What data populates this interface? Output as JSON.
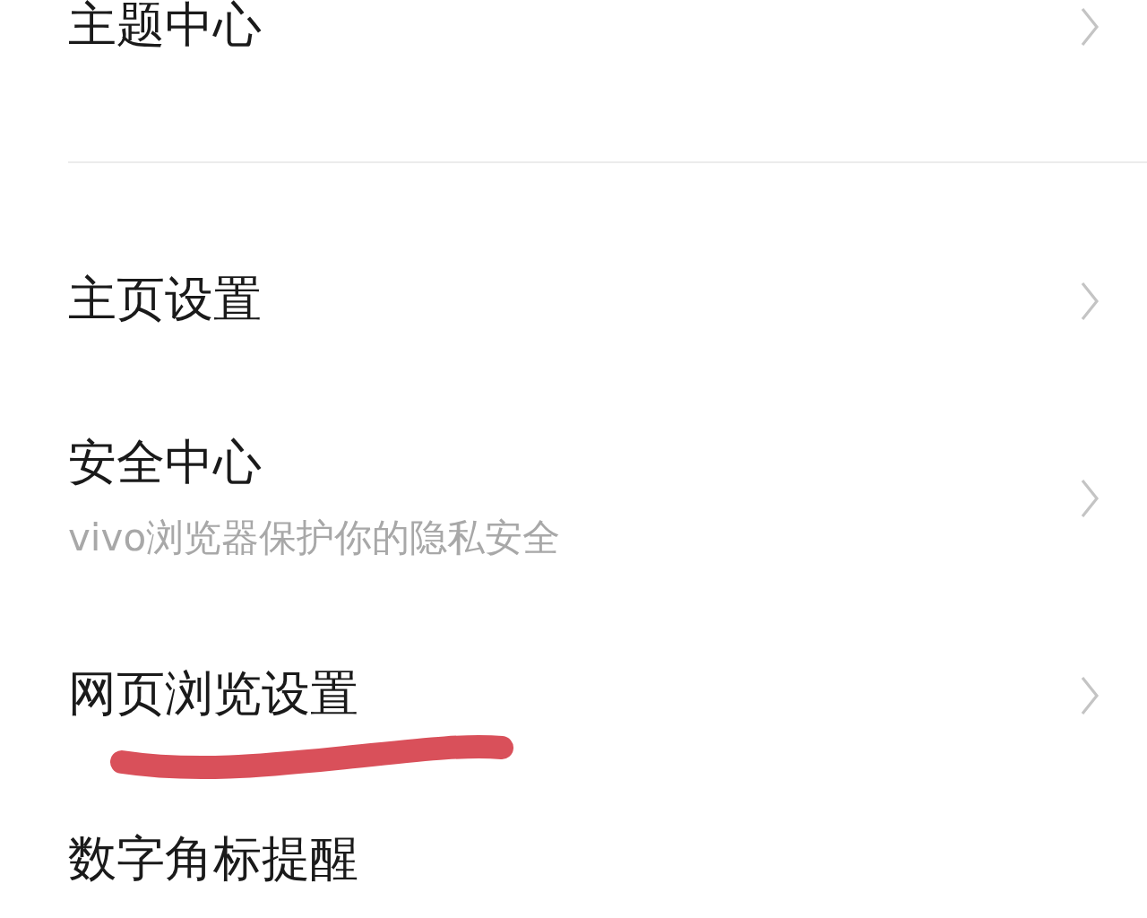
{
  "groups": [
    {
      "items": [
        {
          "title": "主题中心",
          "chevron": true,
          "underlined": false
        }
      ]
    },
    {
      "items": [
        {
          "title": "主页设置",
          "chevron": true,
          "underlined": false
        },
        {
          "title": "安全中心",
          "subtitle": "vivo浏览器保护你的隐私安全",
          "chevron": true,
          "underlined": false
        },
        {
          "title": "网页浏览设置",
          "chevron": true,
          "underlined": true
        },
        {
          "title": "数字角标提醒",
          "chevron": false,
          "underlined": false
        }
      ]
    }
  ]
}
